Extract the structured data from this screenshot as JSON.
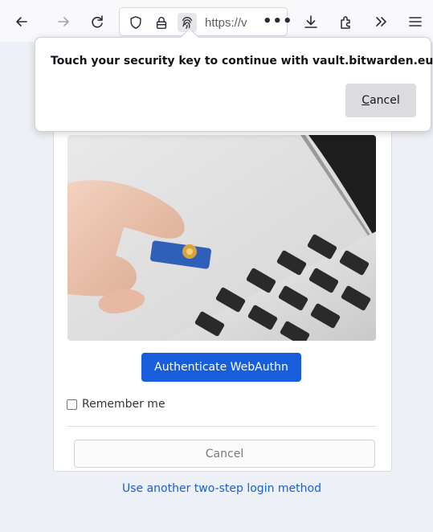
{
  "browser": {
    "url_text": "https://v",
    "url_more": "•••",
    "icons": [
      "back-icon",
      "forward-icon",
      "reload-icon",
      "shield-icon",
      "lock-icon",
      "fingerprint-icon",
      "download-icon",
      "extensions-icon",
      "overflow-chevrons-icon",
      "menu-icon"
    ]
  },
  "popup": {
    "message": "Touch your security key to continue with vault.bitwarden.eu.",
    "cancel_access_key": "C",
    "cancel_rest": "ancel"
  },
  "page": {
    "authenticate_button": "Authenticate WebAuthn",
    "remember_me": "Remember me",
    "cancel_button": "Cancel",
    "another_method_link": "Use another two-step login method"
  },
  "colors": {
    "primary": "#175ddc",
    "page_bg": "#edf0f6",
    "toolbar_bg": "#f9f9fb"
  }
}
